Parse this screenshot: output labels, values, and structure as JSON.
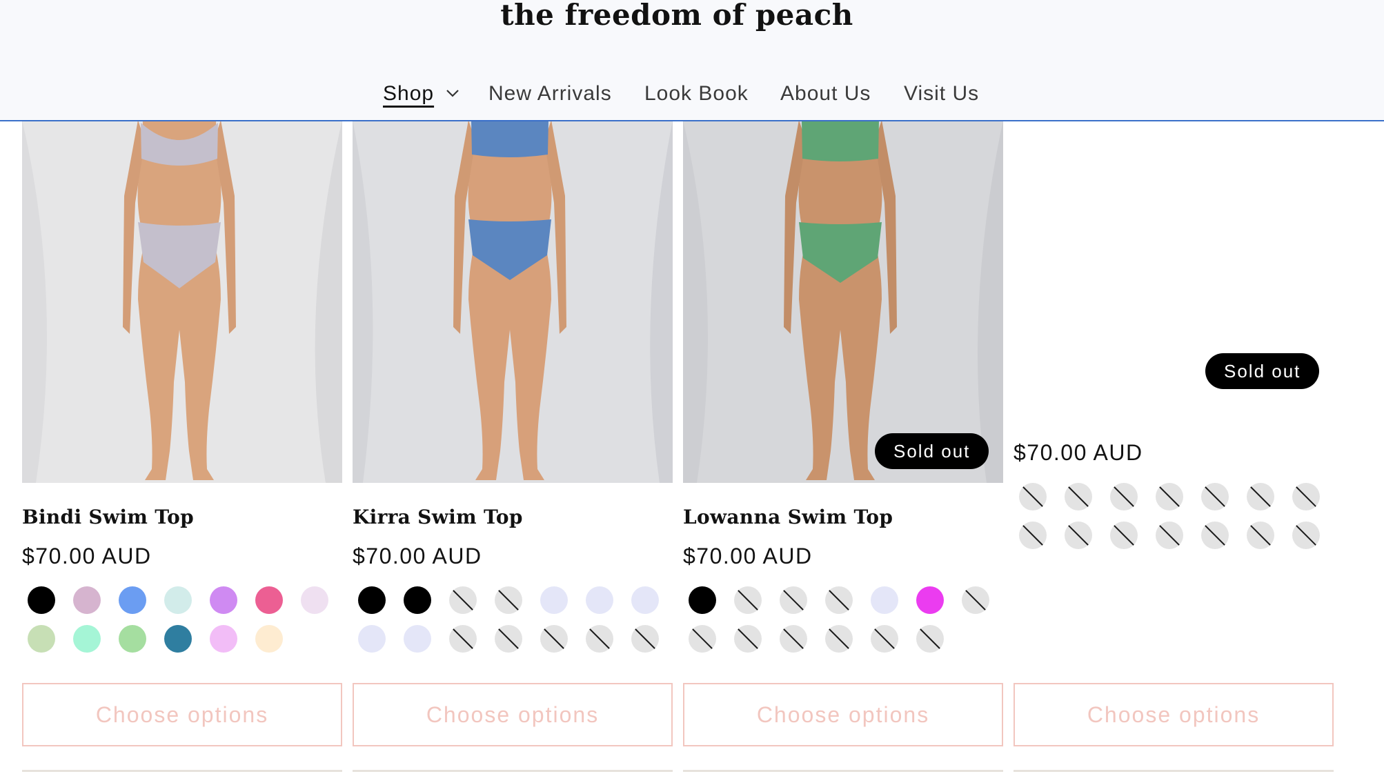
{
  "header": {
    "brand": "the freedom of peach",
    "nav": [
      {
        "label": "Shop",
        "active": true,
        "has_dropdown": true,
        "icon": "chevron-down-icon"
      },
      {
        "label": "New Arrivals"
      },
      {
        "label": "Look Book"
      },
      {
        "label": "About Us"
      },
      {
        "label": "Visit Us"
      }
    ]
  },
  "products": [
    {
      "title": "Bindi Swim Top",
      "price": "$70.00 AUD",
      "sold_out": false,
      "swatch_colors": [
        "#000000",
        "#d6b4cf",
        "#6b9df2",
        "#d2ecea",
        "#cf8af2",
        "#ec5f93",
        "#efe0f1",
        "#c7dfb5",
        "#a5f5d6",
        "#a5dea0",
        "#2f7ea0",
        "#f2bdf7",
        "#feecd1"
      ],
      "button": "Choose options",
      "theme": {
        "swimsuit": "#bfb8cc",
        "backdrop": "#e3e3e4"
      }
    },
    {
      "title": "Kirra Swim Top",
      "price": "$70.00 AUD",
      "sold_out": false,
      "swatch_colors": [
        "#000000",
        "#000000",
        "unavailable",
        "unavailable",
        "#e4e6f8",
        "#e4e6f8",
        "#e4e6f8",
        "#e4e6f8",
        "#e4e6f8",
        "unavailable",
        "unavailable",
        "unavailable",
        "unavailable",
        "unavailable"
      ],
      "button": "Choose options",
      "theme": {
        "swimsuit": "#5b86c0",
        "backdrop": "#dcdde0"
      }
    },
    {
      "title": "Lowanna Swim Top",
      "price": "$70.00 AUD",
      "sold_out": true,
      "badge": "Sold out",
      "swatch_colors": [
        "#000000",
        "unavailable",
        "unavailable",
        "unavailable",
        "#e4e6f8",
        "#eb3cf0",
        "unavailable",
        "unavailable",
        "unavailable",
        "unavailable",
        "unavailable",
        "unavailable",
        "unavailable"
      ],
      "button": "Choose options",
      "theme": {
        "swimsuit": "#5fa575",
        "backdrop": "#d4d5d8"
      }
    },
    {
      "title": "",
      "price": "$70.00 AUD",
      "sold_out": true,
      "badge": "Sold out",
      "swatch_colors": [
        "unavailable",
        "unavailable",
        "unavailable",
        "unavailable",
        "unavailable",
        "unavailable",
        "unavailable",
        "unavailable",
        "unavailable",
        "unavailable",
        "unavailable",
        "unavailable",
        "unavailable",
        "unavailable"
      ],
      "button": "Choose options"
    }
  ]
}
